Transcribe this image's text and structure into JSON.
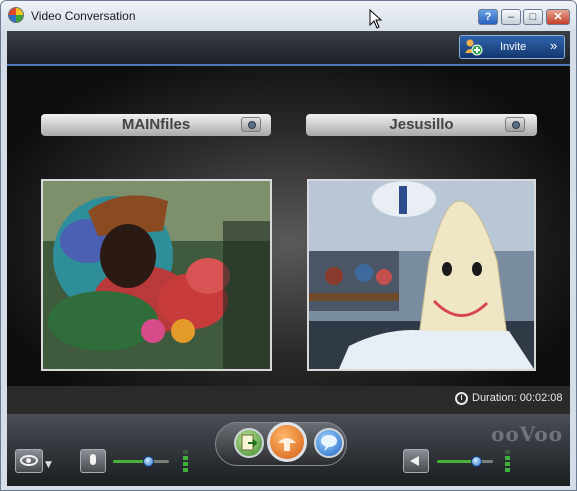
{
  "window": {
    "title": "Video Conversation",
    "help_label": "?",
    "minimize_label": "–",
    "maximize_label": "□",
    "close_label": "✕"
  },
  "toolbar": {
    "invite_label": "Invite",
    "invite_arrow": "»"
  },
  "participants": [
    {
      "name": "MAINfiles"
    },
    {
      "name": "Jesusillo"
    }
  ],
  "status": {
    "duration_label": "Duration:",
    "duration_value": "00:02:08"
  },
  "controls": {
    "eye_dropdown": "▼",
    "mic_level": 0.6,
    "speaker_level": 0.7,
    "watermark": "ooVoo"
  },
  "colors": {
    "accent": "#2f62ad",
    "level_green": "#3fb33a"
  },
  "icons": [
    "app-icon",
    "invite-user-icon",
    "camera-icon",
    "clock-icon",
    "eye-icon",
    "microphone-icon",
    "speaker-icon",
    "send-file-icon",
    "call-icon",
    "chat-icon"
  ]
}
